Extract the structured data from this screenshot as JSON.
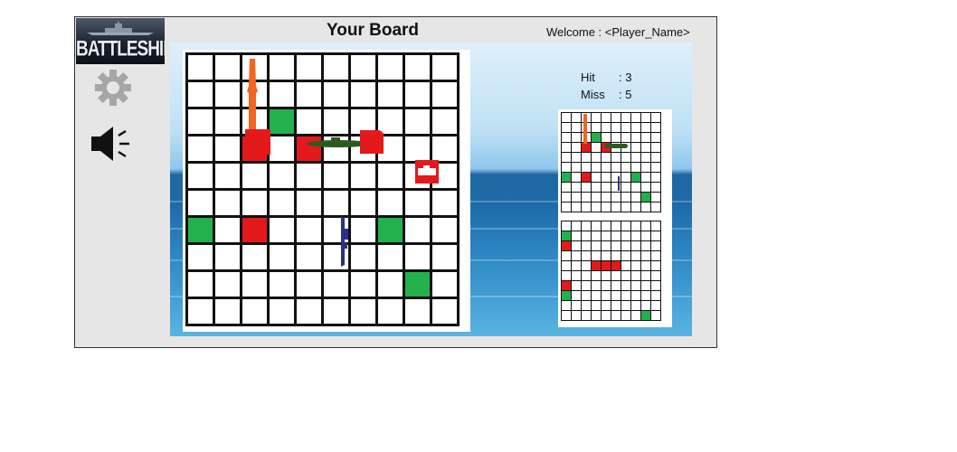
{
  "header": {
    "logo_text": "BATTLESHIP",
    "title": "Your Board",
    "welcome": "Welcome : <Player_Name>"
  },
  "toolbar": {
    "settings_icon": "gear-icon",
    "sound_icon": "speaker-icon"
  },
  "stats": {
    "hit_label": "Hit",
    "hit_value": ": 3",
    "miss_label": "Miss",
    "miss_value": ": 5"
  },
  "boards": {
    "size": 10,
    "main": {
      "green": [
        [
          0,
          6
        ],
        [
          2,
          3
        ],
        [
          3,
          2
        ],
        [
          7,
          6
        ],
        [
          8,
          8
        ]
      ],
      "red": [
        [
          2,
          3
        ],
        [
          2,
          6
        ],
        [
          4,
          3
        ]
      ]
    },
    "own_mini": {
      "green": [
        [
          0,
          6
        ],
        [
          2,
          3
        ],
        [
          3,
          2
        ],
        [
          7,
          6
        ],
        [
          8,
          8
        ]
      ],
      "red": [
        [
          2,
          3
        ],
        [
          2,
          6
        ],
        [
          4,
          3
        ]
      ]
    },
    "target_mini": {
      "green": [
        [
          0,
          1
        ],
        [
          0,
          7
        ],
        [
          8,
          9
        ]
      ],
      "red": [
        [
          0,
          2
        ],
        [
          0,
          6
        ],
        [
          3,
          4
        ],
        [
          4,
          4
        ],
        [
          5,
          4
        ]
      ]
    }
  },
  "colors": {
    "hit_green": "#22b14c",
    "miss_red": "#e3191c",
    "carrier": "#f26522",
    "submarine": "#2d5a1f",
    "destroyer": "#2b2f8c"
  }
}
